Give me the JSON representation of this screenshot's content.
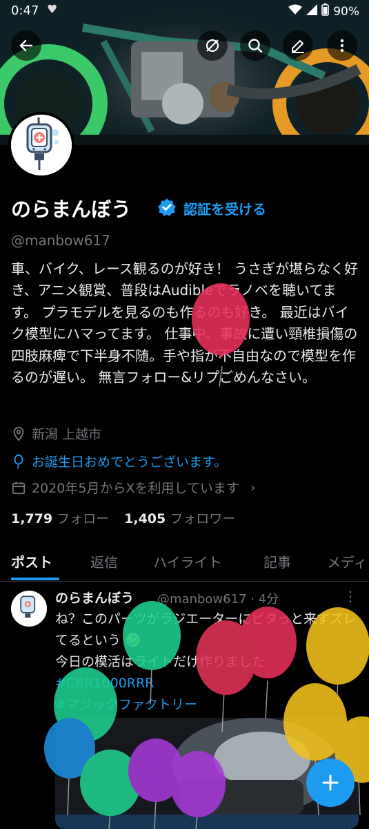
{
  "status_bar": {
    "time": "0:47",
    "battery": "90%"
  },
  "header": {
    "back_icon": "arrow-left-icon",
    "actions": [
      "grok-icon",
      "search-icon",
      "edit-icon",
      "more-vertical-icon"
    ]
  },
  "profile": {
    "display_name": "のらまんぼう",
    "verify_link": "認証を受ける",
    "handle": "@manbow617",
    "bio": "車、バイク、レース観るのが好き！ うさぎが堪らなく好き、アニメ観賞、普段はAudibleでラノベを聴いてます。 プラモデルを見るのも作るのも好き。 最近はバイク模型にハマってます。 仕事中、事故に遭い頸椎損傷の四肢麻痺で下半身不随。手や指が不自由なので模型を作るのが遅い。 無言フォロー&リプごめんなさい。",
    "location": "新潟 上越市",
    "birthday": "お誕生日おめでとうございます。",
    "joined": "2020年5月からXを利用しています",
    "following_count": "1,779",
    "following_label": "フォロー",
    "followers_count": "1,405",
    "followers_label": "フォロワー"
  },
  "tabs": [
    "ポスト",
    "返信",
    "ハイライト",
    "記事",
    "メディア"
  ],
  "post": {
    "name": "のらまんぼう",
    "meta": "@manbow617 · 4分",
    "line1": "ね？このパーツがラジエーターにピタっと来ずズレてるという",
    "line2": "今日の模活はライトだけ作りました",
    "tag1": "#CBR1000RRR",
    "tag2": "#マジックファクトリー"
  },
  "colors": {
    "accent": "#1d9bf0",
    "background": "#000000",
    "muted": "#71767b"
  }
}
